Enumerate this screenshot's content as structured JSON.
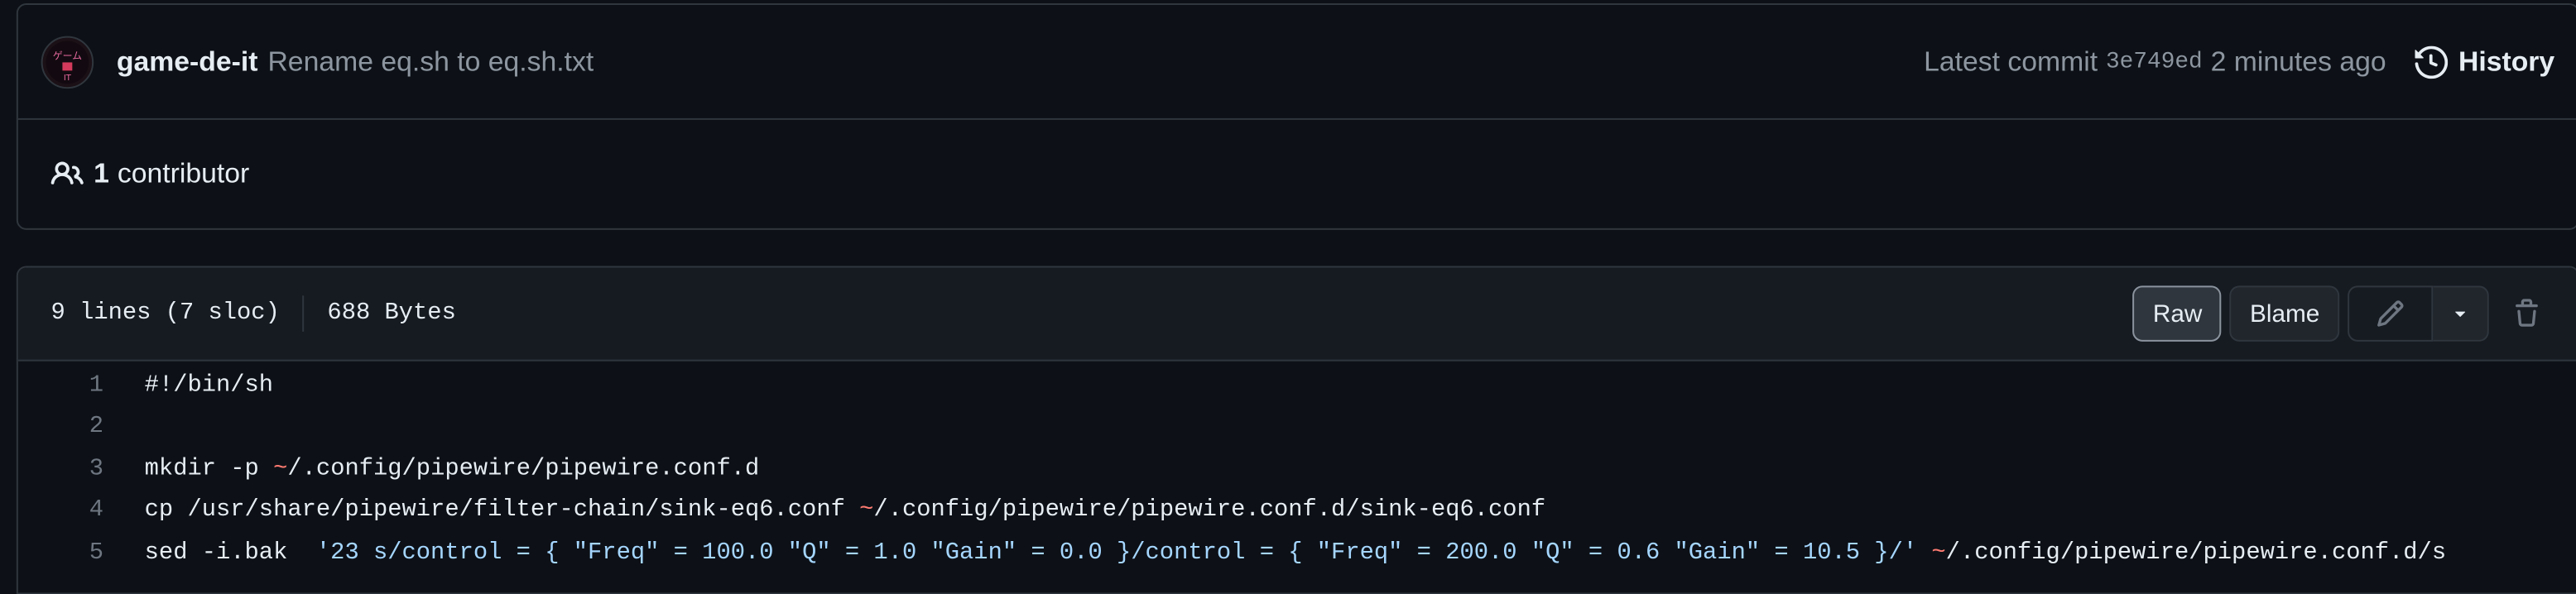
{
  "commit": {
    "author": "game-de-it",
    "message": "Rename eq.sh to eq.sh.txt",
    "latest_label": "Latest commit",
    "sha": "3e749ed",
    "time": "2 minutes ago",
    "history_label": "History"
  },
  "contributors": {
    "count": "1",
    "label": "contributor"
  },
  "file": {
    "lines": "9 lines (7 sloc)",
    "size": "688 Bytes",
    "raw_label": "Raw",
    "blame_label": "Blame"
  },
  "code": [
    {
      "n": "1",
      "parts": [
        {
          "t": "#!/bin/sh",
          "c": "lc"
        }
      ]
    },
    {
      "n": "2",
      "parts": [
        {
          "t": "",
          "c": "lc"
        }
      ]
    },
    {
      "n": "3",
      "parts": [
        {
          "t": "mkdir -p ",
          "c": "lc"
        },
        {
          "t": "~",
          "c": "tilde"
        },
        {
          "t": "/.config/pipewire/pipewire.conf.d",
          "c": "lc"
        }
      ]
    },
    {
      "n": "4",
      "parts": [
        {
          "t": "cp /usr/share/pipewire/filter-chain/sink-eq6.conf ",
          "c": "lc"
        },
        {
          "t": "~",
          "c": "tilde"
        },
        {
          "t": "/.config/pipewire/pipewire.conf.d/sink-eq6.conf",
          "c": "lc"
        }
      ]
    },
    {
      "n": "5",
      "parts": [
        {
          "t": "sed -i.bak  ",
          "c": "lc"
        },
        {
          "t": "'23 s/control = { \"Freq\" = 100.0 \"Q\" = 1.0 \"Gain\" = 0.0 }/control = { \"Freq\" = 200.0 \"Q\" = 0.6 \"Gain\" = 10.5 }/'",
          "c": "str"
        },
        {
          "t": " ",
          "c": "lc"
        },
        {
          "t": "~",
          "c": "tilde"
        },
        {
          "t": "/.config/pipewire/pipewire.conf.d/s",
          "c": "lc"
        }
      ]
    }
  ],
  "colors": {
    "background": "#0d1117",
    "border": "#30363d",
    "muted_text": "#8d96a0",
    "tilde": "#ff7b72",
    "string": "#a5d6ff"
  },
  "icons": {
    "history": "history-icon",
    "contributors": "people-icon",
    "edit": "pencil-icon",
    "dropdown": "triangle-down-icon",
    "delete": "trash-icon"
  }
}
